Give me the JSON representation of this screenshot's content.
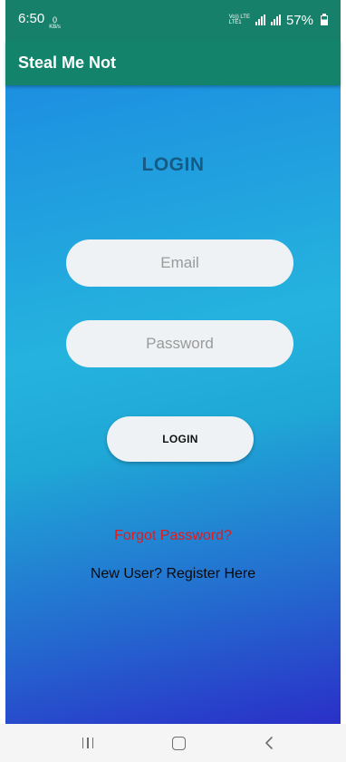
{
  "status_bar": {
    "time": "6:50",
    "net_speed_value": "0",
    "net_speed_unit": "KB/s",
    "volte_label": "Vo)) LTE",
    "lte_label": "LTE1",
    "battery": "57%"
  },
  "app_bar": {
    "title": "Steal Me Not"
  },
  "login": {
    "heading": "LOGIN",
    "email_placeholder": "Email",
    "email_value": "",
    "password_placeholder": "Password",
    "password_value": "",
    "button_label": "LOGIN",
    "forgot_password": "Forgot Password?",
    "register": "New User? Register Here"
  },
  "colors": {
    "app_bar": "#14836b",
    "heading": "#155b86",
    "forgot_link": "#e31a1a"
  },
  "nav_bar": {
    "icons": [
      "recent-apps-icon",
      "home-icon",
      "back-icon"
    ]
  }
}
